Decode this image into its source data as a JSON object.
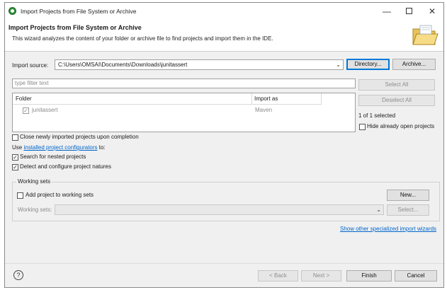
{
  "window": {
    "title": "Import Projects from File System or Archive",
    "controls": {
      "minimize": "—",
      "maximize": "",
      "close": "✕"
    }
  },
  "header": {
    "title": "Import Projects from File System or Archive",
    "description": "This wizard analyzes the content of your folder or archive file to find projects and import them in the IDE."
  },
  "import_source": {
    "label": "Import source:",
    "value": "C:\\Users\\OMSAI\\Documents\\Downloads\\junitassert",
    "directory_button": "Directory...",
    "archive_button": "Archive..."
  },
  "filter": {
    "placeholder": "type filter text"
  },
  "table": {
    "columns": [
      "Folder",
      "Import as"
    ],
    "rows": [
      {
        "folder": "junitassert",
        "import_as": "Maven",
        "checked": true
      }
    ]
  },
  "selection": {
    "select_all": "Select All",
    "deselect_all": "Deselect All",
    "status": "1 of 1 selected",
    "hide_open_label": "Hide already open projects"
  },
  "options": {
    "close_after": "Close newly imported projects upon completion",
    "use_prefix": "Use",
    "configurators_link": "installed project configurators",
    "use_suffix": "to:",
    "search_nested": "Search for nested projects",
    "detect_natures": "Detect and configure project natures"
  },
  "working_sets": {
    "legend": "Working sets",
    "add_label": "Add project to working sets",
    "new_button": "New...",
    "sets_label": "Working sets:",
    "select_button": "Select..."
  },
  "wizards_link": "Show other specialized import wizards",
  "footer": {
    "help": "?",
    "back": "< Back",
    "next": "Next >",
    "finish": "Finish",
    "cancel": "Cancel"
  }
}
